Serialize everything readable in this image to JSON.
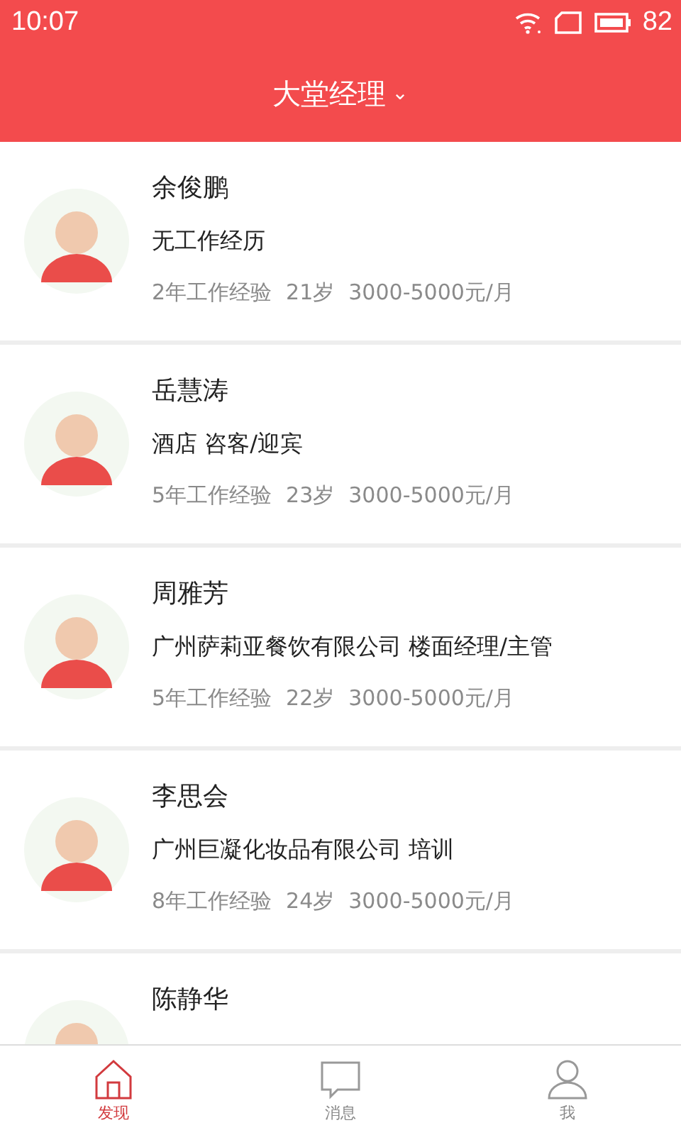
{
  "status_bar": {
    "time": "10:07",
    "battery": "82"
  },
  "header": {
    "title": "大堂经理",
    "dropdown": "⌄"
  },
  "candidates": [
    {
      "name": "余俊鹏",
      "experience": "无工作经历",
      "years": "2年工作经验",
      "age": "21岁",
      "salary": "3000-5000元/月"
    },
    {
      "name": "岳慧涛",
      "experience": "酒店 咨客/迎宾",
      "years": "5年工作经验",
      "age": "23岁",
      "salary": "3000-5000元/月"
    },
    {
      "name": "周雅芳",
      "experience": "广州萨莉亚餐饮有限公司 楼面经理/主管",
      "years": "5年工作经验",
      "age": "22岁",
      "salary": "3000-5000元/月"
    },
    {
      "name": "李思会",
      "experience": "广州巨凝化妆品有限公司 培训",
      "years": "8年工作经验",
      "age": "24岁",
      "salary": "3000-5000元/月"
    },
    {
      "name": "陈静华"
    }
  ],
  "tabs": [
    {
      "label": "发现",
      "kind": "home",
      "selected": true
    },
    {
      "label": "消息",
      "kind": "chat",
      "selected": false
    },
    {
      "label": "我",
      "kind": "person",
      "selected": false
    }
  ]
}
